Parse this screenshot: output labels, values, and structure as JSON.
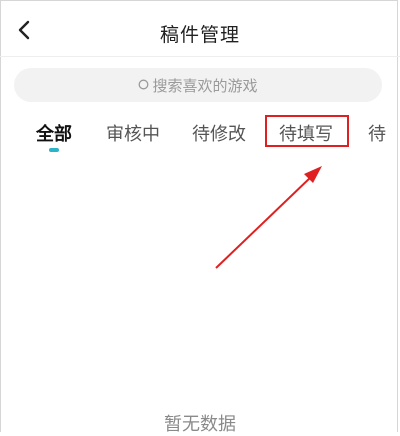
{
  "header": {
    "title": "稿件管理",
    "back_icon": "chevron-left-icon"
  },
  "search": {
    "placeholder": "搜索喜欢的游戏",
    "icon": "search-icon"
  },
  "tabs": [
    {
      "label": "全部",
      "active": true
    },
    {
      "label": "审核中",
      "active": false
    },
    {
      "label": "待修改",
      "active": false
    },
    {
      "label": "待填写",
      "active": false,
      "highlighted": true
    },
    {
      "label": "待",
      "active": false
    }
  ],
  "empty_state": {
    "text": "暂无数据"
  },
  "colors": {
    "accent": "#2bb3c8",
    "annotation": "#e02020"
  }
}
